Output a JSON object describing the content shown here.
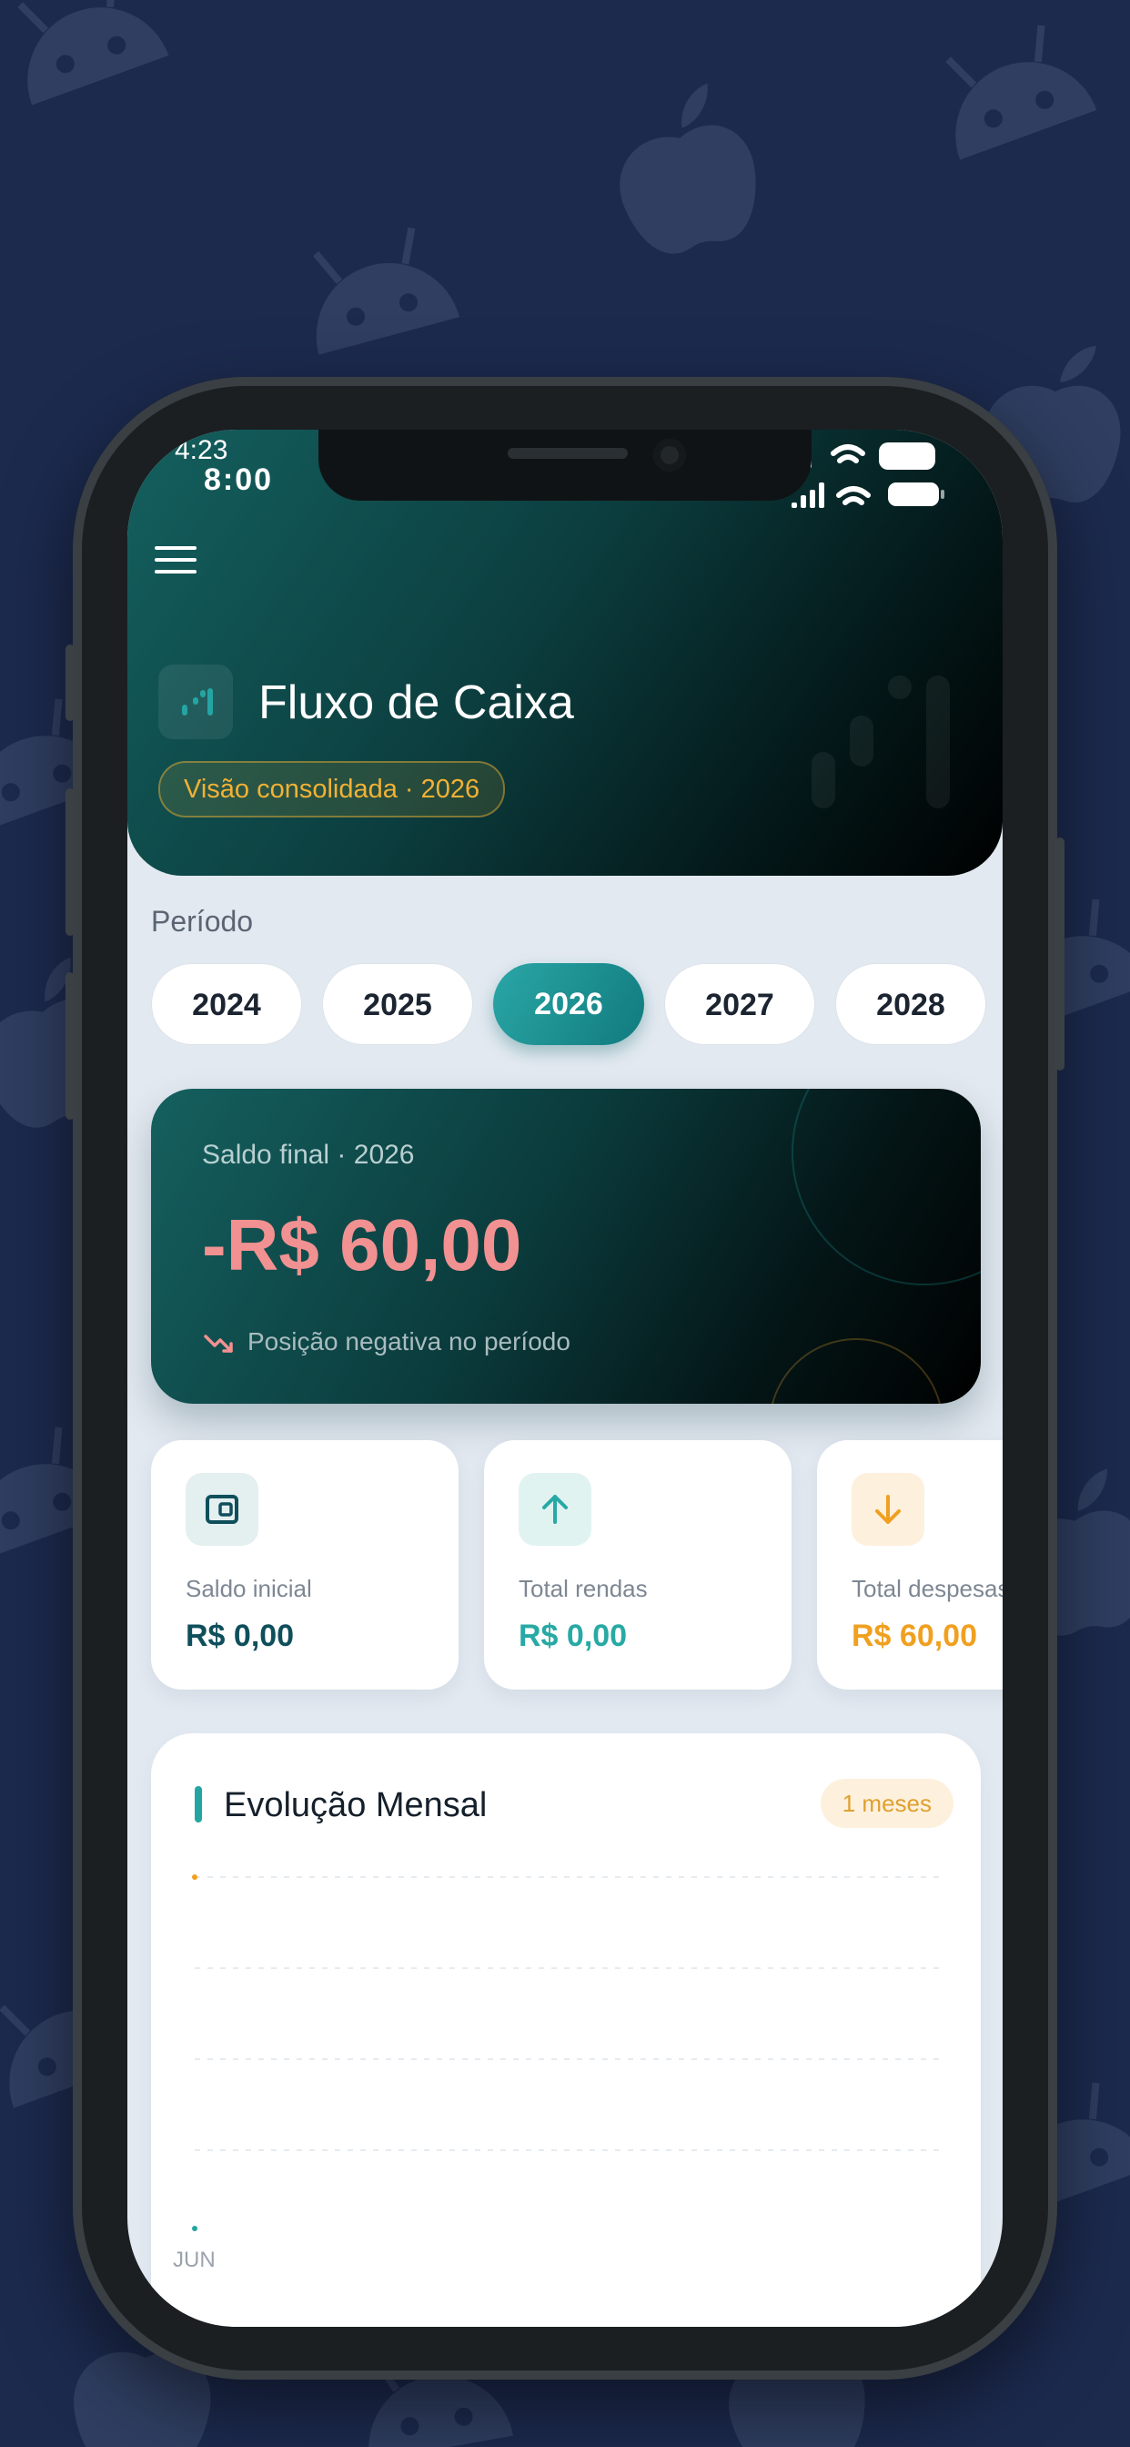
{
  "status_bar": {
    "time_small": "4:23",
    "time": "8:00"
  },
  "header": {
    "menu_icon": "hamburger-icon",
    "logo_icon": "bar-chart-icon",
    "title": "Fluxo de Caixa",
    "subtitle": "Visão consolidada · 2026"
  },
  "period": {
    "label": "Período",
    "years": [
      "2024",
      "2025",
      "2026",
      "2027",
      "2028"
    ],
    "selected": "2026"
  },
  "balance": {
    "label": "Saldo final · 2026",
    "value": "-R$ 60,00",
    "note": "Posição negativa no período",
    "value_color": "#f19191"
  },
  "summary": [
    {
      "label": "Saldo inicial",
      "value": "R$ 0,00",
      "icon": "wallet-icon",
      "color": "#0f4f5c"
    },
    {
      "label": "Total rendas",
      "value": "R$ 0,00",
      "icon": "arrow-up-icon",
      "color": "#27a9a4"
    },
    {
      "label": "Total despesas",
      "value": "R$ 60,00",
      "icon": "arrow-down-icon",
      "color": "#f0a020"
    }
  ],
  "chart": {
    "title": "Evolução Mensal",
    "badge": "1 meses"
  },
  "chart_data": {
    "type": "line",
    "categories": [
      "JUN"
    ],
    "series": [
      {
        "values": [
          0
        ],
        "color": "#24a5a3"
      },
      {
        "values": [
          60
        ],
        "color": "#f0a020"
      }
    ],
    "ylim": [
      0,
      60
    ],
    "grid": true
  },
  "colors": {
    "accent": "#24a5a3",
    "warning": "#f2b134",
    "negative": "#f19191",
    "background": "#1c2a4e"
  }
}
